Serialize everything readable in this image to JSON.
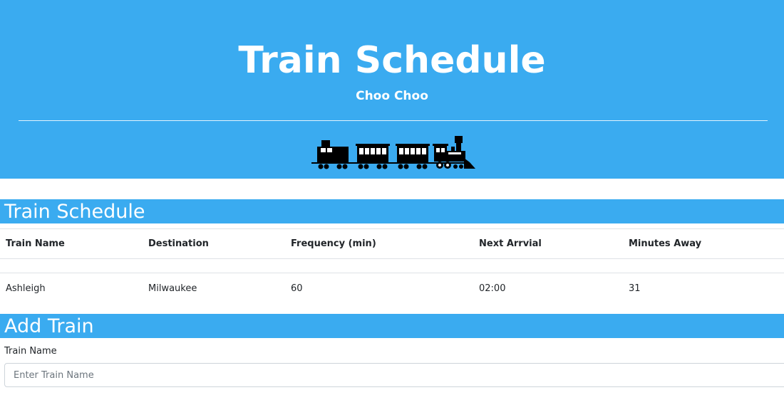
{
  "header": {
    "title": "Train Schedule",
    "subtitle": "Choo Choo",
    "image_icon": "train-silhouette"
  },
  "schedule_section": {
    "heading": "Train Schedule",
    "columns": [
      "Train Name",
      "Destination",
      "Frequency (min)",
      "Next Arrvial",
      "Minutes Away"
    ],
    "rows": [
      [
        "Ashleigh",
        "Milwaukee",
        "60",
        "02:00",
        "31"
      ]
    ]
  },
  "add_section": {
    "heading": "Add Train",
    "name_label": "Train Name",
    "name_placeholder": "Enter Train Name",
    "name_value": ""
  },
  "colors": {
    "accent": "#3aabf0",
    "text": "#212529"
  }
}
